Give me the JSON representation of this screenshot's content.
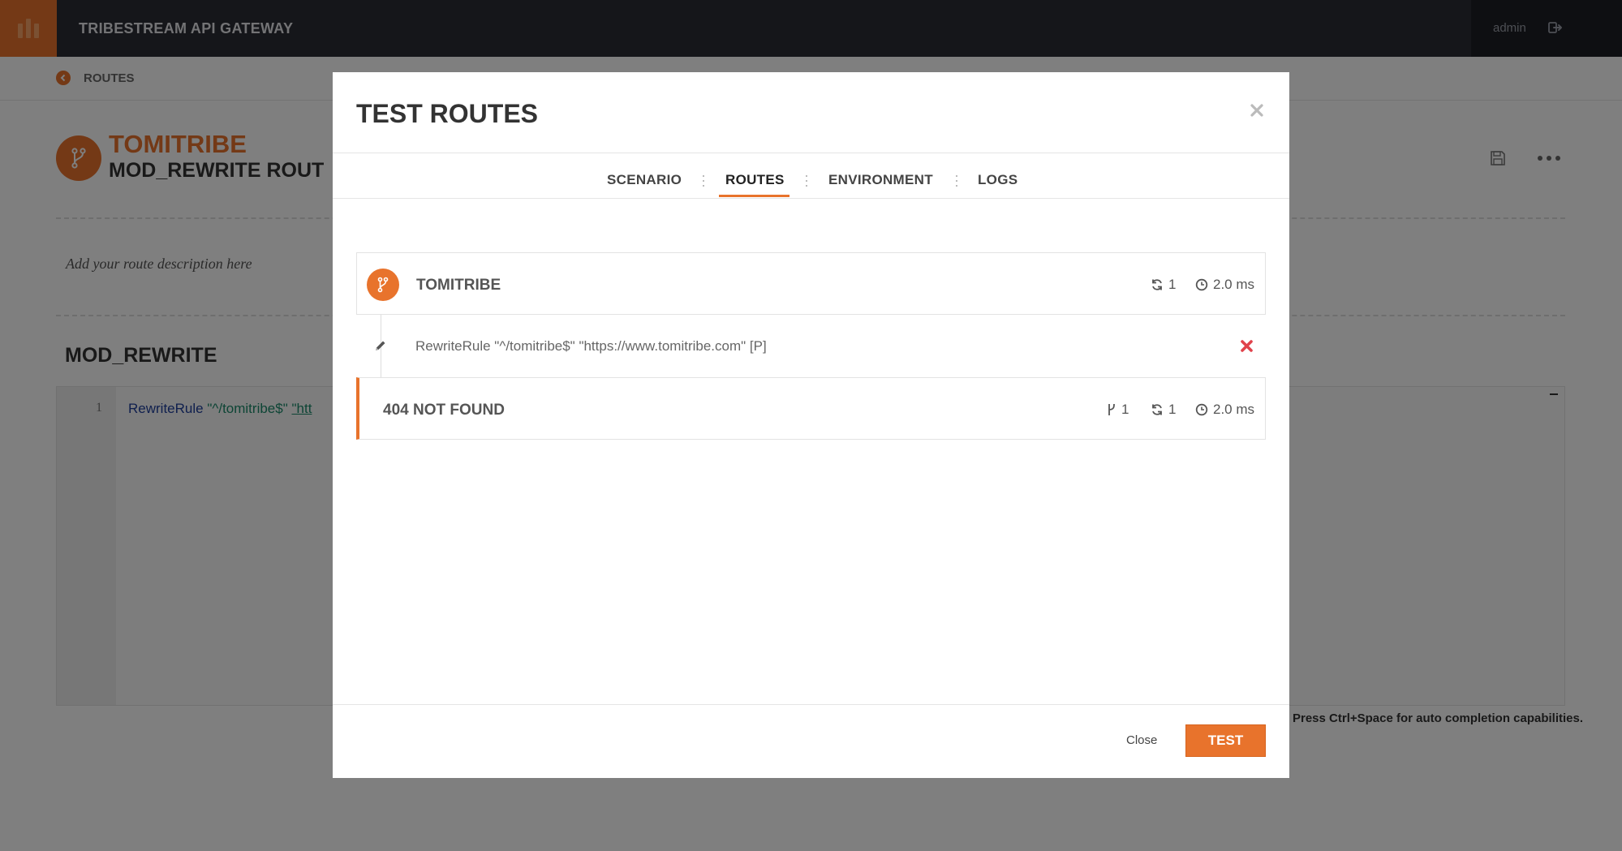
{
  "app": {
    "title": "TRIBESTREAM API GATEWAY",
    "user": "admin"
  },
  "icons": {
    "logo": "logo-bars-icon",
    "logout": "logout-icon",
    "back": "chevron-left-icon",
    "route": "branch-icon",
    "save": "save-icon",
    "more": "more-icon",
    "close": "close-icon",
    "refresh": "refresh-icon",
    "clock": "clock-icon",
    "pencil": "pencil-icon",
    "remove": "remove-icon"
  },
  "colors": {
    "accent": "#e8732c",
    "nav_bg": "#2a2d35",
    "danger": "#e0424b"
  },
  "page": {
    "breadcrumb": "ROUTES",
    "route_title": "TOMITRIBE",
    "route_subtitle": "MOD_REWRITE ROUT",
    "description_placeholder": "Add your route description here",
    "section_title": "MOD_REWRITE",
    "editor": {
      "line_number": "1",
      "keyword": "RewriteRule",
      "pattern": "\"^/tomitribe$\"",
      "target_partial": "\"htt"
    },
    "hint": "Press Ctrl+Space for auto completion capabilities."
  },
  "modal": {
    "title": "TEST ROUTES",
    "tabs": [
      {
        "label": "SCENARIO",
        "active": false
      },
      {
        "label": "ROUTES",
        "active": true
      },
      {
        "label": "ENVIRONMENT",
        "active": false
      },
      {
        "label": "LOGS",
        "active": false
      }
    ],
    "route_card": {
      "name": "TOMITRIBE",
      "iterations": "1",
      "time": "2.0 ms"
    },
    "rule": {
      "text": "RewriteRule \"^/tomitribe$\" \"https://www.tomitribe.com\" [P]"
    },
    "result_card": {
      "name": "404 NOT FOUND",
      "routes": "1",
      "iterations": "1",
      "time": "2.0 ms"
    },
    "footer": {
      "close_label": "Close",
      "test_label": "TEST"
    }
  }
}
